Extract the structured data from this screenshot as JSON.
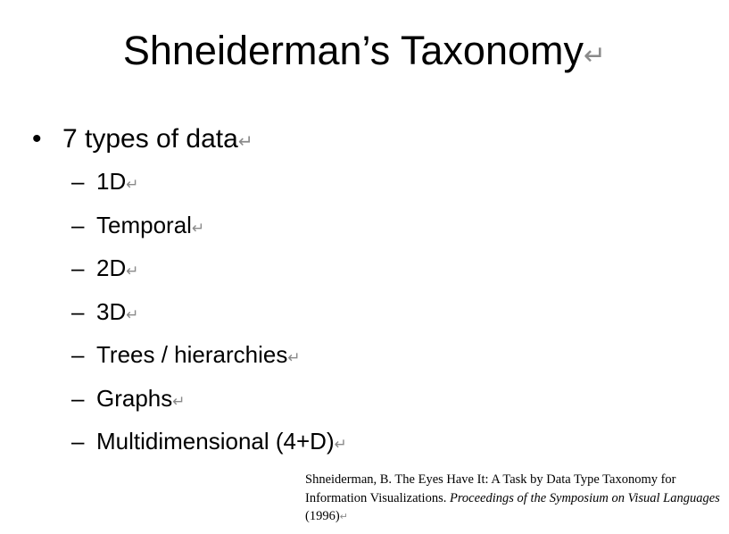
{
  "slide": {
    "title": "Shneiderman’s Taxonomy",
    "paragraph_mark": "↵",
    "bullet": {
      "marker": "•",
      "text": "7 types of data"
    },
    "sub_marker": "–",
    "sub_items": [
      "1D",
      "Temporal",
      "2D",
      "3D",
      "Trees / hierarchies",
      "Graphs",
      "Multidimensional (4+D)"
    ],
    "citation": {
      "lead": "Shneiderman, B. The Eyes Have It: A Task by Data Type Taxonomy for Information Visualizations. ",
      "venue": "Proceedings of the Symposium on Visual Languages",
      "year": " (1996)"
    },
    "colors": {
      "text": "#000000",
      "paragraph_mark": "#8a8a8a",
      "background": "#ffffff"
    }
  }
}
